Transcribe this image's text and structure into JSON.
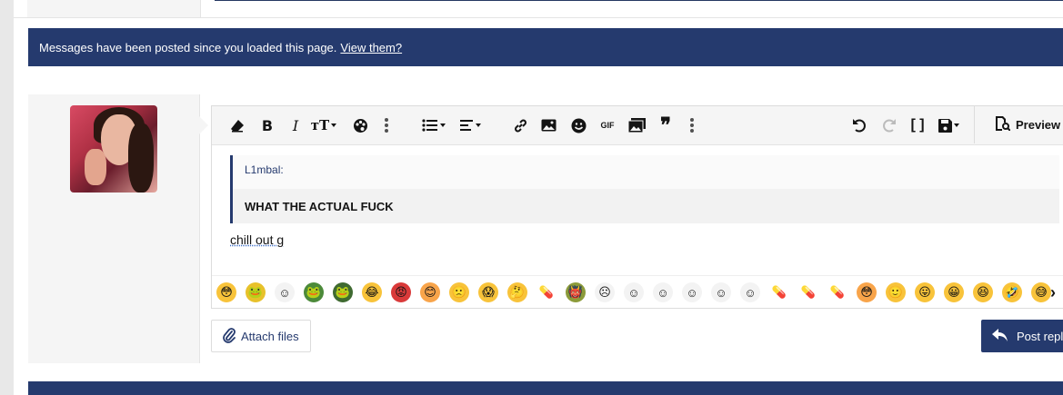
{
  "notice": {
    "text": "Messages have been posted since you loaded this page.",
    "link": "View them?"
  },
  "toolbar": {
    "items": [
      "clear-formatting",
      "bold",
      "italic",
      "font-size",
      "text-color",
      "more",
      "list",
      "align",
      "more",
      "link",
      "image",
      "smilies",
      "gif",
      "media",
      "quote",
      "more",
      "undo",
      "redo",
      "bbcode",
      "drafts"
    ],
    "preview_label": "Preview"
  },
  "quote": {
    "attribution": "L1mbal:",
    "body": "WHAT THE ACTUAL FUCK"
  },
  "reply": {
    "text": "chill out g"
  },
  "emojis": [
    {
      "name": "flushed",
      "glyph": "😳",
      "bg": "#f8c33a"
    },
    {
      "name": "pepe-yellow",
      "glyph": "🐸",
      "bg": "#e8c12b"
    },
    {
      "name": "troll-face",
      "glyph": "☺",
      "bg": "#f3f3f3"
    },
    {
      "name": "pepe",
      "glyph": "🐸",
      "bg": "#4c8a3a"
    },
    {
      "name": "pepe-screen",
      "glyph": "🐸",
      "bg": "#3f6a31"
    },
    {
      "name": "crying-laugh",
      "glyph": "😂",
      "bg": "#f8c33a"
    },
    {
      "name": "angry",
      "glyph": "😡",
      "bg": "#d93a3a"
    },
    {
      "name": "smiling",
      "glyph": "😊",
      "bg": "#f8a44a"
    },
    {
      "name": "frown",
      "glyph": "🙁",
      "bg": "#f8c33a"
    },
    {
      "name": "scream",
      "glyph": "😱",
      "bg": "#f8c33a"
    },
    {
      "name": "thinking",
      "glyph": "🤔",
      "bg": "#f8c33a"
    },
    {
      "name": "red-pill",
      "glyph": "💊",
      "bg": "#ffffff"
    },
    {
      "name": "shrek",
      "glyph": "👹",
      "bg": "#8c9b3a"
    },
    {
      "name": "rage-face",
      "glyph": "☹",
      "bg": "#f3f3f3"
    },
    {
      "name": "meme-face-1",
      "glyph": "☺",
      "bg": "#f3f3f3"
    },
    {
      "name": "meme-face-2",
      "glyph": "☺",
      "bg": "#f3f3f3"
    },
    {
      "name": "meme-face-3",
      "glyph": "☺",
      "bg": "#f3f3f3"
    },
    {
      "name": "meme-face-4",
      "glyph": "☺",
      "bg": "#f3f3f3"
    },
    {
      "name": "meme-face-5",
      "glyph": "☺",
      "bg": "#f3f3f3"
    },
    {
      "name": "black-pill",
      "glyph": "💊",
      "bg": "#ffffff"
    },
    {
      "name": "red-pill-2",
      "glyph": "💊",
      "bg": "#ffffff"
    },
    {
      "name": "blue-pill",
      "glyph": "💊",
      "bg": "#ffffff"
    },
    {
      "name": "blushing",
      "glyph": "😳",
      "bg": "#f8a44a"
    },
    {
      "name": "smile",
      "glyph": "🙂",
      "bg": "#f8c33a"
    },
    {
      "name": "tongue",
      "glyph": "😛",
      "bg": "#f8c33a"
    },
    {
      "name": "grin",
      "glyph": "😀",
      "bg": "#f8c33a"
    },
    {
      "name": "laughing",
      "glyph": "😆",
      "bg": "#f8c33a"
    },
    {
      "name": "rofl",
      "glyph": "🤣",
      "bg": "#f8c33a"
    },
    {
      "name": "sweat",
      "glyph": "😅",
      "bg": "#f8c33a"
    }
  ],
  "attach": {
    "label": "Attach files"
  },
  "post": {
    "label": "Post reply"
  },
  "colors": {
    "brand": "#253a6e",
    "panel": "#f5f5f5"
  }
}
